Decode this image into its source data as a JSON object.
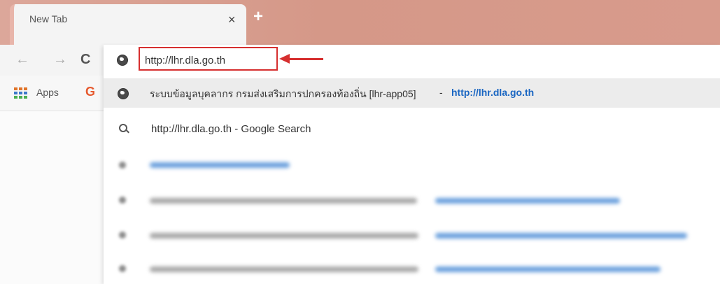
{
  "tab": {
    "title": "New Tab",
    "close_glyph": "×",
    "new_tab_glyph": "+"
  },
  "toolbar": {
    "back_glyph": "←",
    "forward_glyph": "→",
    "reload_glyph": "C"
  },
  "omnibox": {
    "value": "http://lhr.dla.go.th",
    "icon": "globe-icon"
  },
  "bookmarks": {
    "apps_label": "Apps",
    "google_glyph": "G"
  },
  "suggestions": [
    {
      "icon": "globe-icon",
      "title": "ระบบข้อมูลบุคลากร กรมส่งเสริมการปกครองท้องถิ่น [lhr-app05]",
      "separator": "-",
      "url": "http://lhr.dla.go.th"
    },
    {
      "icon": "search-icon",
      "text": "http://lhr.dla.go.th - Google Search"
    }
  ],
  "colors": {
    "highlight_box": "#d62f2f",
    "link_blue": "#1a66c2",
    "tab_strip": "#d59888",
    "selected_row": "#ececec"
  }
}
